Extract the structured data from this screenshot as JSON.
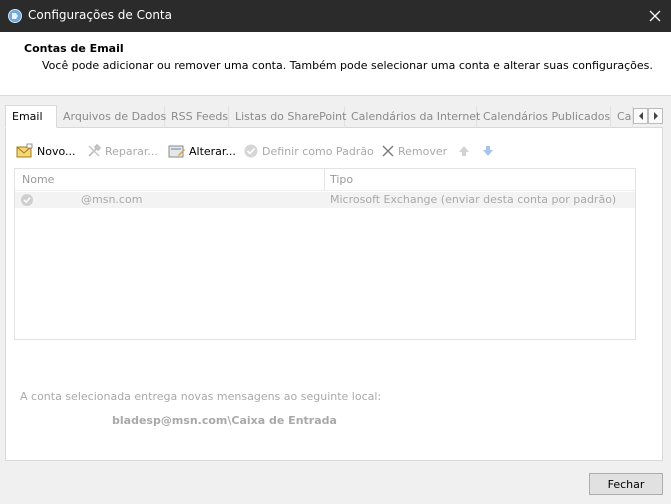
{
  "window": {
    "title": "Configurações de Conta",
    "close_label": "✕"
  },
  "header": {
    "title": "Contas de Email",
    "description": "Você pode adicionar ou remover uma conta. Também pode selecionar uma conta e alterar suas configurações."
  },
  "tabs": [
    {
      "label": "Email",
      "active": true
    },
    {
      "label": "Arquivos de Dados"
    },
    {
      "label": "RSS Feeds"
    },
    {
      "label": "Listas do SharePoint"
    },
    {
      "label": "Calendários da Internet"
    },
    {
      "label": "Calendários Publicados"
    },
    {
      "label": "Ca"
    }
  ],
  "toolbar": {
    "new_label": "Novo...",
    "repair_label": "Reparar...",
    "change_label": "Alterar...",
    "set_default_label": "Definir como Padrão",
    "remove_label": "Remover"
  },
  "list": {
    "columns": [
      "Nome",
      "Tipo"
    ],
    "rows": [
      {
        "name": "@msn.com",
        "type": "Microsoft Exchange (enviar desta conta por padrão)"
      }
    ]
  },
  "delivery": {
    "label": "A conta selecionada entrega novas mensagens ao seguinte local:",
    "value": "bladesp@msn.com\\Caixa de Entrada"
  },
  "footer": {
    "close_button": "Fechar"
  },
  "colors": {
    "titlebar_bg": "#2b2b2b",
    "dialog_bg": "#f0f0f0",
    "disabled_text": "#a9a9a9"
  }
}
